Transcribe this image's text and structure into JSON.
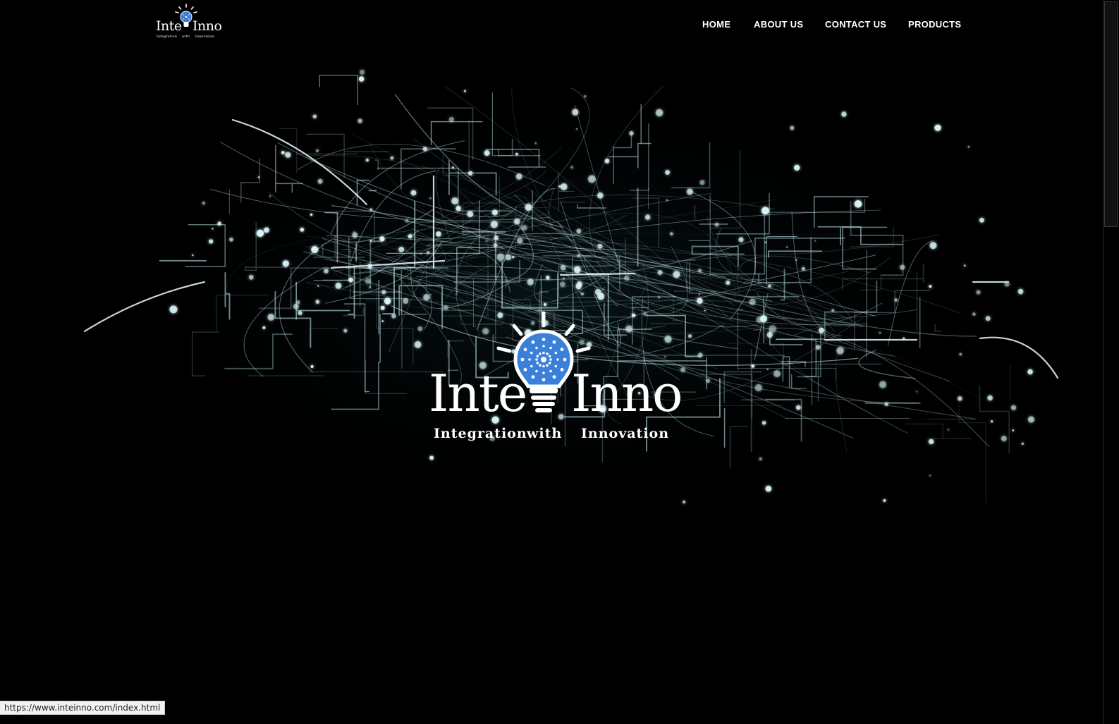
{
  "brand": {
    "word_left": "Inte",
    "word_right": "Inno",
    "tagline_1": "Integration",
    "tagline_2": "with",
    "tagline_3": "Innovation",
    "bulb_color": "#3a7fd8",
    "bulb_icon": "lightbulb-icon"
  },
  "nav": {
    "items": [
      {
        "label": "HOME"
      },
      {
        "label": "ABOUT US"
      },
      {
        "label": "CONTACT US"
      },
      {
        "label": "PRODUCTS"
      }
    ]
  },
  "hero": {
    "word_left": "Inte",
    "word_right": "Inno",
    "tagline_1": "Integration",
    "tagline_2": "with",
    "tagline_3": "Innovation",
    "background": "dark-network-particles",
    "network_color": "#bfe7ee"
  },
  "status_bar": {
    "url": "https://www.inteinno.com/index.html"
  }
}
